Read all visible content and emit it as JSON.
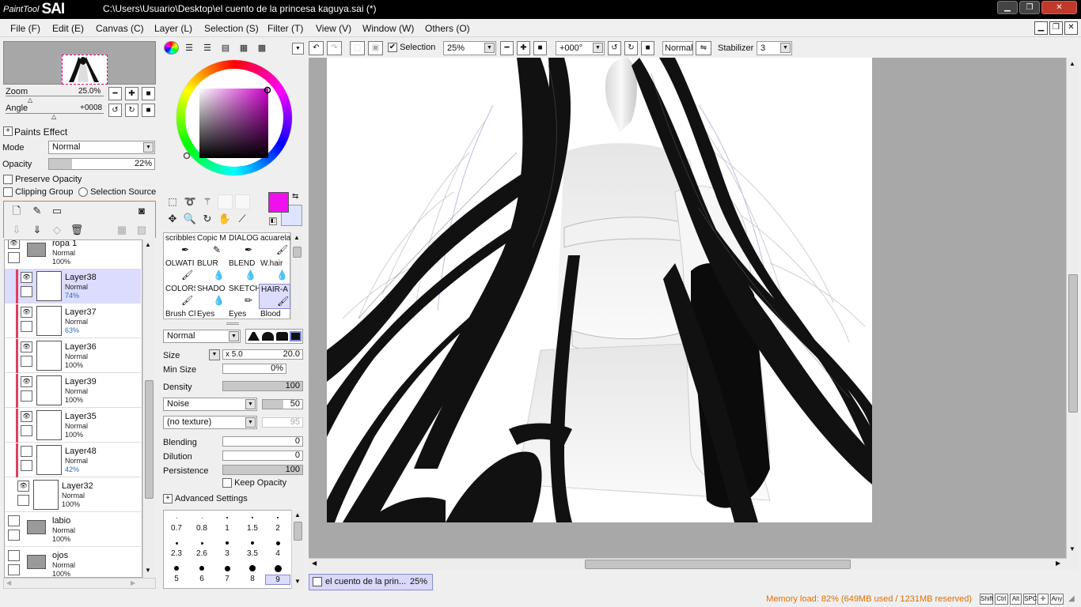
{
  "app": {
    "logo_small": "PaintTool",
    "logo_big": "SAI",
    "title": "C:\\Users\\Usuario\\Desktop\\el cuento de la princesa kaguya.sai (*)"
  },
  "menu": [
    "File (F)",
    "Edit (E)",
    "Canvas (C)",
    "Layer (L)",
    "Selection (S)",
    "Filter (T)",
    "View (V)",
    "Window (W)",
    "Others (O)"
  ],
  "navigator": {
    "zoom_label": "Zoom",
    "zoom_value": "25.0%",
    "angle_label": "Angle",
    "angle_value": "+0008"
  },
  "paints_effect": {
    "header": "Paints Effect",
    "mode_label": "Mode",
    "mode_value": "Normal",
    "opacity_label": "Opacity",
    "opacity_value": "22%",
    "opacity_level": 0.22,
    "preserve_opacity": "Preserve Opacity",
    "clipping_group": "Clipping Group",
    "selection_source": "Selection Source"
  },
  "layers": [
    {
      "name": "ropa 1",
      "mode": "Normal",
      "opacity": "100%",
      "type": "folder",
      "visible": true,
      "clip": false,
      "selected": false
    },
    {
      "name": "Layer38",
      "mode": "Normal",
      "opacity": "74%",
      "type": "layer",
      "visible": true,
      "clip": true,
      "selected": true
    },
    {
      "name": "Layer37",
      "mode": "Normal",
      "opacity": "63%",
      "type": "layer",
      "visible": true,
      "clip": true,
      "selected": false
    },
    {
      "name": "Layer36",
      "mode": "Normal",
      "opacity": "100%",
      "type": "layer",
      "visible": true,
      "clip": true,
      "selected": false
    },
    {
      "name": "Layer39",
      "mode": "Normal",
      "opacity": "100%",
      "type": "layer",
      "visible": true,
      "clip": true,
      "selected": false
    },
    {
      "name": "Layer35",
      "mode": "Normal",
      "opacity": "100%",
      "type": "layer",
      "visible": true,
      "clip": true,
      "selected": false
    },
    {
      "name": "Layer48",
      "mode": "Normal",
      "opacity": "42%",
      "type": "layer",
      "visible": false,
      "clip": true,
      "selected": false
    },
    {
      "name": "Layer32",
      "mode": "Normal",
      "opacity": "100%",
      "type": "layer",
      "visible": true,
      "clip": false,
      "selected": false
    },
    {
      "name": "labio",
      "mode": "Normal",
      "opacity": "100%",
      "type": "folder",
      "visible": false,
      "clip": false,
      "selected": false
    },
    {
      "name": "ojos",
      "mode": "Normal",
      "opacity": "100%",
      "type": "folder",
      "visible": false,
      "clip": false,
      "selected": false
    }
  ],
  "colors": {
    "primary": "#ee11ee",
    "secondary": "#dce4ff",
    "accent_clip": "#e04060",
    "selected_layer": "#dcdcff",
    "memory_text": "#e07000"
  },
  "brushes": [
    {
      "label": "scribbles",
      "icon": "pen"
    },
    {
      "label": "Copic M",
      "icon": "marker"
    },
    {
      "label": "DIALOG",
      "icon": "pen"
    },
    {
      "label": "acuarela",
      "icon": "brush"
    },
    {
      "label": "OLWATI",
      "icon": "brush"
    },
    {
      "label": "BLUR",
      "icon": "drop"
    },
    {
      "label": "BLEND",
      "icon": "drop"
    },
    {
      "label": "W.hair",
      "icon": "drop"
    },
    {
      "label": "COLORS",
      "icon": "brush"
    },
    {
      "label": "SHADO",
      "icon": "drop"
    },
    {
      "label": "SKETCH",
      "icon": "pencil"
    },
    {
      "label": "HAIR-A",
      "icon": "brush"
    },
    {
      "label": "Brush Cl",
      "icon": ""
    },
    {
      "label": "Eyes",
      "icon": ""
    },
    {
      "label": "Eyes",
      "icon": ""
    },
    {
      "label": "Blood",
      "icon": ""
    }
  ],
  "brush_settings": {
    "mode": "Normal",
    "size_label": "Size",
    "size_multiplier": "x 5.0",
    "size_value": "20.0",
    "min_size_label": "Min Size",
    "min_size_value": "0%",
    "density_label": "Density",
    "density_value": "100",
    "shape": "Noise",
    "shape_value": "50",
    "texture": "(no texture)",
    "texture_value": "95",
    "blending_label": "Blending",
    "blending_value": "0",
    "dilution_label": "Dilution",
    "dilution_value": "0",
    "persistence_label": "Persistence",
    "persistence_value": "100",
    "keep_opacity": "Keep Opacity",
    "advanced_settings": "Advanced Settings"
  },
  "brush_sizes": [
    "0.7",
    "0.8",
    "1",
    "1.5",
    "2",
    "2.3",
    "2.6",
    "3",
    "3.5",
    "4",
    "5",
    "6",
    "7",
    "8",
    "9"
  ],
  "canvas_toolbar": {
    "selection_label": "Selection",
    "zoom": "25%",
    "angle": "+000°",
    "blend_mode": "Normal",
    "stabilizer_label": "Stabilizer",
    "stabilizer_value": "3"
  },
  "document_tab": {
    "name": "el cuento de la prin...",
    "zoom": "25%"
  },
  "status": {
    "memory": "Memory load: 82% (649MB used / 1231MB reserved)",
    "keys": [
      "Shift",
      "Ctrl",
      "Alt",
      "SPC",
      "✛",
      "Any"
    ]
  }
}
